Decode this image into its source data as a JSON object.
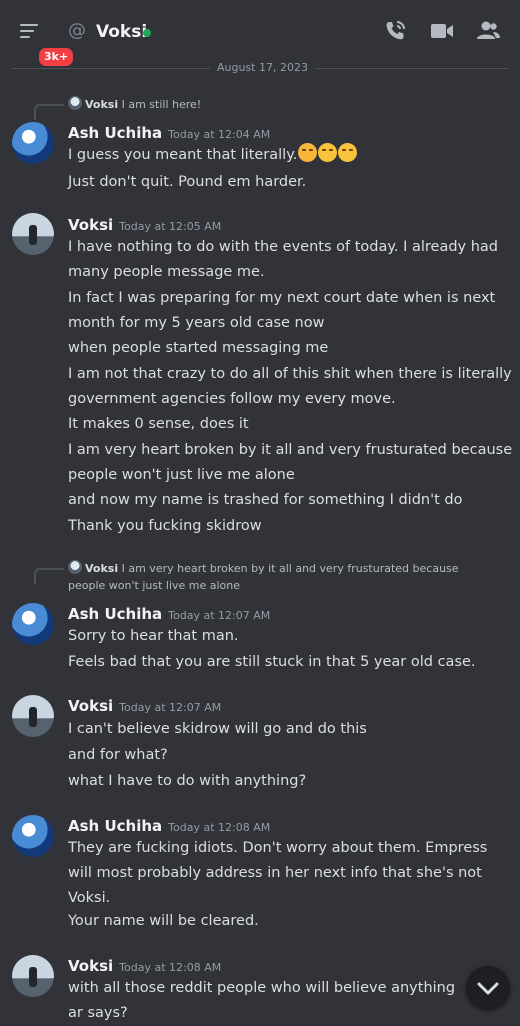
{
  "header": {
    "unread_badge": "3k+",
    "channel_prefix": "@",
    "channel_name": "Voksi",
    "icons": [
      "menu-icon",
      "phone-call-icon",
      "video-call-icon",
      "members-icon"
    ]
  },
  "date_divider": "August 17, 2023",
  "messages": [
    {
      "reply": {
        "author": "Voksi",
        "text": "I am still here!"
      },
      "author": "Ash Uchiha",
      "time": "Today at 12:04 AM",
      "lines": [
        "I guess you meant that literally.",
        "Just don't quit. Pound em harder."
      ],
      "emojis": [
        "flushed-face",
        "grinning-squinting-face",
        "grinning-squinting-face"
      ]
    },
    {
      "author": "Voksi",
      "time": "Today at 12:05 AM",
      "lines": [
        "I have nothing to do with the events of today. I already had many people message me.",
        "In fact I was preparing for my next court date when is next month for my 5 years old case now",
        "when people started messaging me",
        "I am not that crazy to do all of this shit when there is literally government agencies follow my every move.",
        "It makes 0 sense, does it",
        "I am very heart broken by it all and very frusturated because people won't just live me alone",
        "and now my name is trashed for something I didn't do",
        "Thank you fucking skidrow"
      ]
    },
    {
      "reply": {
        "author": "Voksi",
        "text": "I am very heart broken by it all and very frusturated because people won't just live me alone"
      },
      "author": "Ash Uchiha",
      "time": "Today at 12:07 AM",
      "lines": [
        "Sorry to hear that man.",
        "Feels bad that you are still stuck in that 5 year old case."
      ]
    },
    {
      "author": "Voksi",
      "time": "Today at 12:07 AM",
      "lines": [
        "I can't believe skidrow will go and do this",
        "and for what?",
        "what I have to do with anything?"
      ]
    },
    {
      "author": "Ash Uchiha",
      "time": "Today at 12:08 AM",
      "lines": [
        "They are fucking idiots. Don't worry about them. Empress will most probably address in her next info that she's not Voksi.",
        "Your name will be cleared."
      ]
    },
    {
      "author": "Voksi",
      "time": "Today at 12:08 AM",
      "lines": [
        "with all those reddit people who will believe anything ar says?"
      ]
    }
  ],
  "scroll_button_icon": "chevron-down-icon"
}
